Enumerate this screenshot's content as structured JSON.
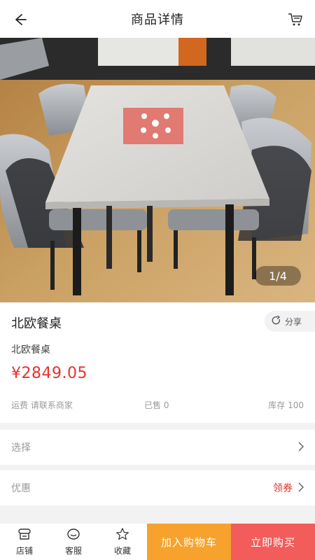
{
  "header": {
    "title": "商品详情",
    "back_icon": "back-arrow-icon",
    "cart_icon": "cart-icon"
  },
  "gallery": {
    "counter": "1/4"
  },
  "product": {
    "name": "北欧餐桌",
    "share_label": "分享",
    "subtitle": "北欧餐桌",
    "price": "¥2849.05",
    "shipping": "运费 请联系商家",
    "sold": "已售 0",
    "stock": "库存 100"
  },
  "options": {
    "select_label": "选择",
    "promo_label": "优惠",
    "coupon_label": "领券"
  },
  "bottom_bar": {
    "shop": "店铺",
    "service": "客服",
    "favorite": "收藏",
    "add_to_cart": "加入购物车",
    "buy_now": "立即购买"
  },
  "colors": {
    "accent_red": "#e8312a",
    "cart_orange": "#f6a22d",
    "buy_red": "#f25c5a"
  }
}
